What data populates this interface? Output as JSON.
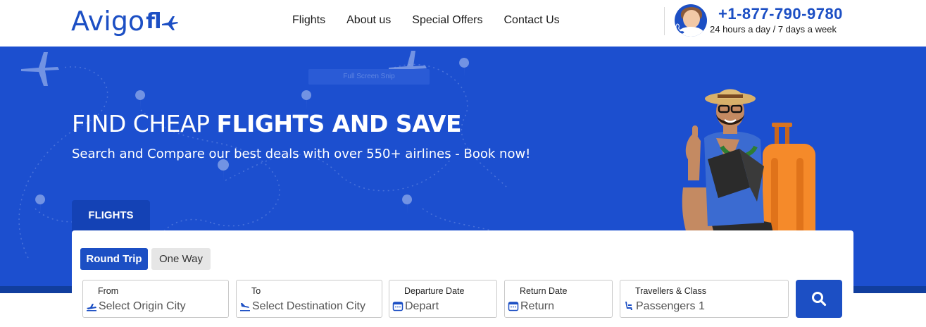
{
  "brand": {
    "logo_part1": "Avigo",
    "logo_part2": "fl"
  },
  "nav": {
    "items": [
      "Flights",
      "About us",
      "Special Offers",
      "Contact Us"
    ]
  },
  "contact": {
    "phone": "+1-877-790-9780",
    "hours": "24 hours a day / 7 days a week"
  },
  "hero": {
    "headline_light": "FIND CHEAP ",
    "headline_bold": "FLIGHTS AND SAVE",
    "subheadline": "Search and Compare our best deals with over 550+ airlines - Book now!",
    "overlay_text": "Full Screen Snip"
  },
  "search": {
    "tab": "FLIGHTS",
    "trip_types": [
      "Round Trip",
      "One Way"
    ],
    "selected_trip_type": "Round Trip",
    "fields": {
      "from": {
        "label": "From",
        "placeholder": "Select Origin City"
      },
      "to": {
        "label": "To",
        "placeholder": "Select Destination City"
      },
      "depart": {
        "label": "Departure Date",
        "placeholder": "Depart"
      },
      "return": {
        "label": "Return Date",
        "placeholder": "Return"
      },
      "travellers": {
        "label": "Travellers & Class",
        "value": "Passengers 1"
      }
    },
    "submit_icon": "search-icon"
  },
  "colors": {
    "brand_blue": "#1c4fc4",
    "hero_blue": "#1c4fcf",
    "tab_blue": "#1442b5"
  }
}
